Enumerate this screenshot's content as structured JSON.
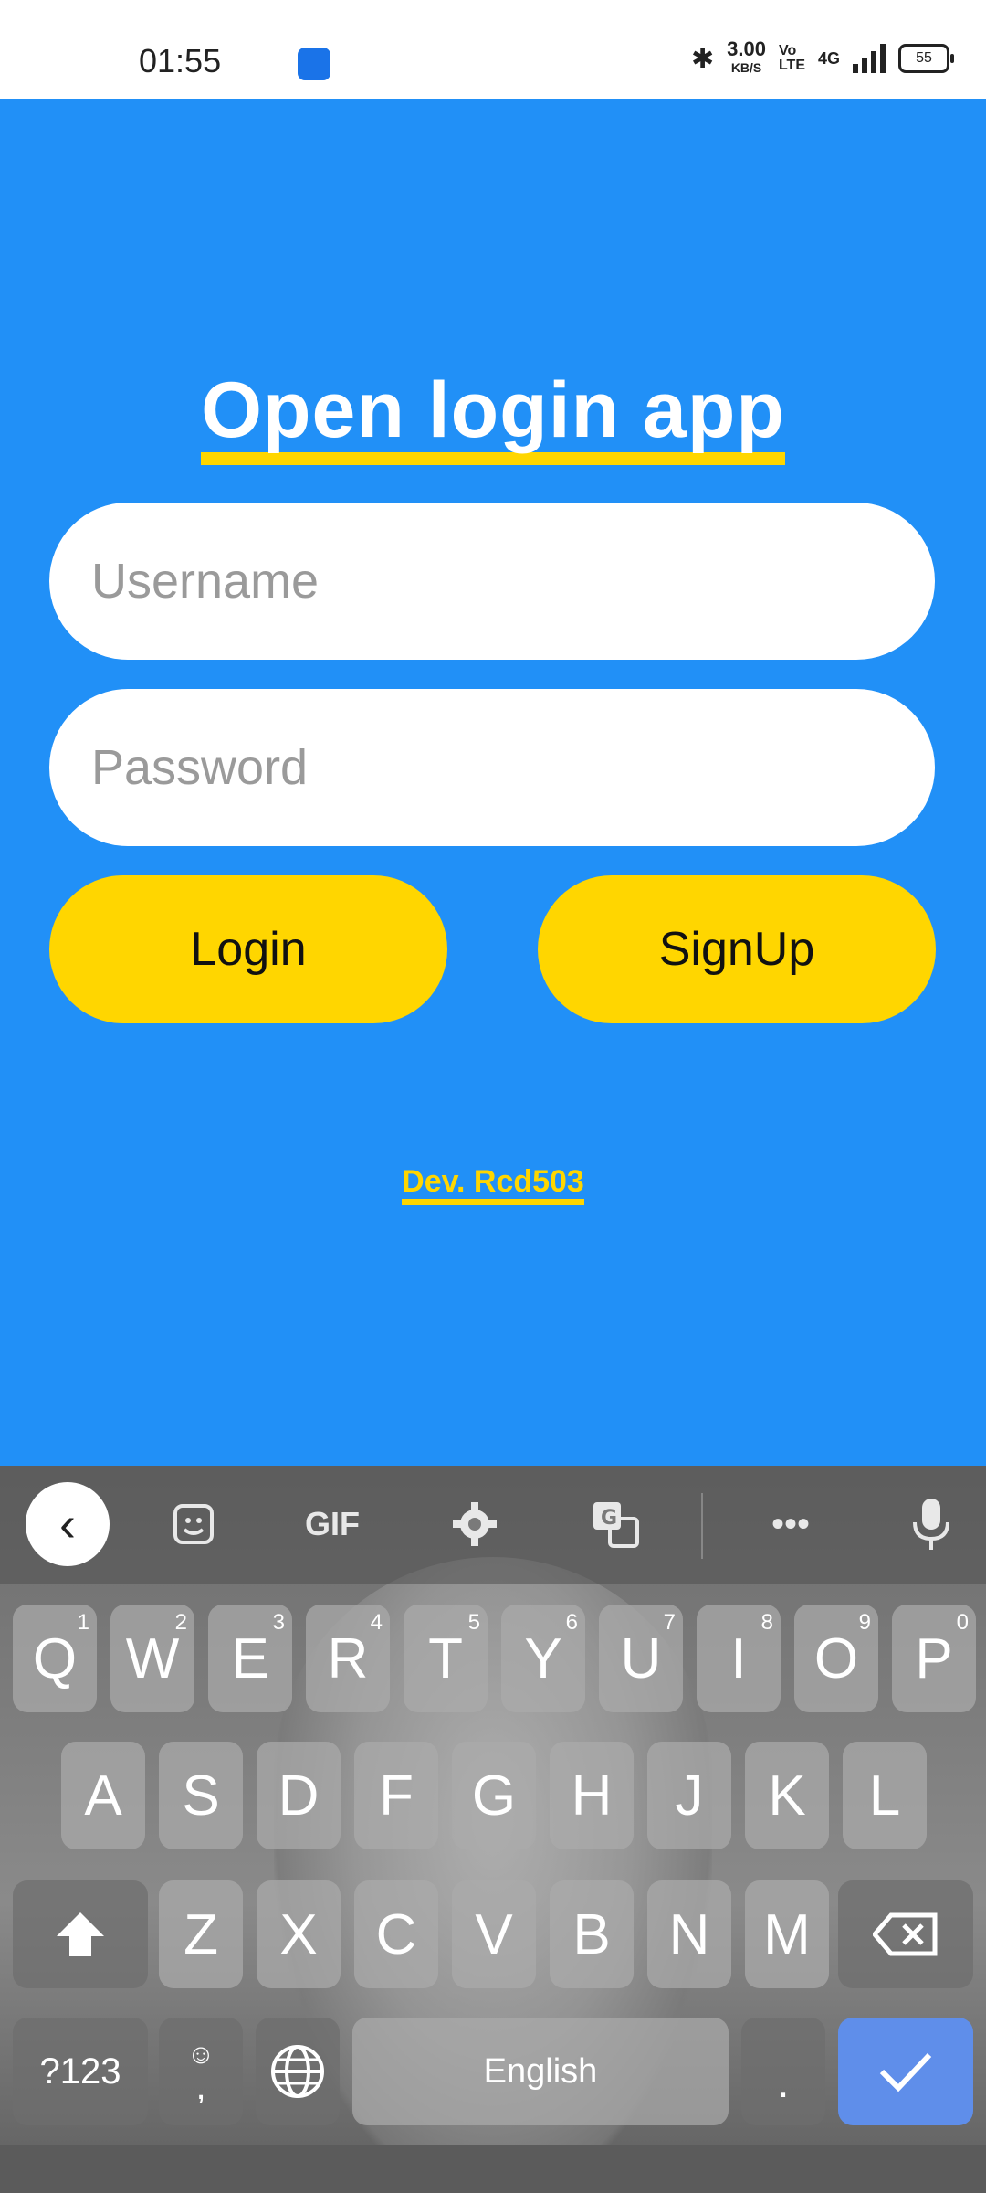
{
  "status_bar": {
    "time": "01:55",
    "speed_value": "3.00",
    "speed_unit": "KB/S",
    "volte_top": "Vo",
    "volte_bottom": "LTE",
    "network": "4G",
    "battery": "55"
  },
  "app": {
    "title": "Open login app",
    "username_placeholder": "Username",
    "password_placeholder": "Password",
    "login_label": "Login",
    "signup_label": "SignUp",
    "dev_credit": "Dev. Rcd503",
    "colors": {
      "background": "#2190f7",
      "accent": "#ffd600"
    }
  },
  "keyboard": {
    "toolbar": {
      "back_icon": "‹",
      "gif_label": "GIF"
    },
    "row1": [
      {
        "key": "Q",
        "num": "1"
      },
      {
        "key": "W",
        "num": "2"
      },
      {
        "key": "E",
        "num": "3"
      },
      {
        "key": "R",
        "num": "4"
      },
      {
        "key": "T",
        "num": "5"
      },
      {
        "key": "Y",
        "num": "6"
      },
      {
        "key": "U",
        "num": "7"
      },
      {
        "key": "I",
        "num": "8"
      },
      {
        "key": "O",
        "num": "9"
      },
      {
        "key": "P",
        "num": "0"
      }
    ],
    "row2": [
      "A",
      "S",
      "D",
      "F",
      "G",
      "H",
      "J",
      "K",
      "L"
    ],
    "row3": [
      "Z",
      "X",
      "C",
      "V",
      "B",
      "N",
      "M"
    ],
    "row4": {
      "symbols": "?123",
      "comma": ",",
      "space": "English",
      "period": "."
    }
  }
}
